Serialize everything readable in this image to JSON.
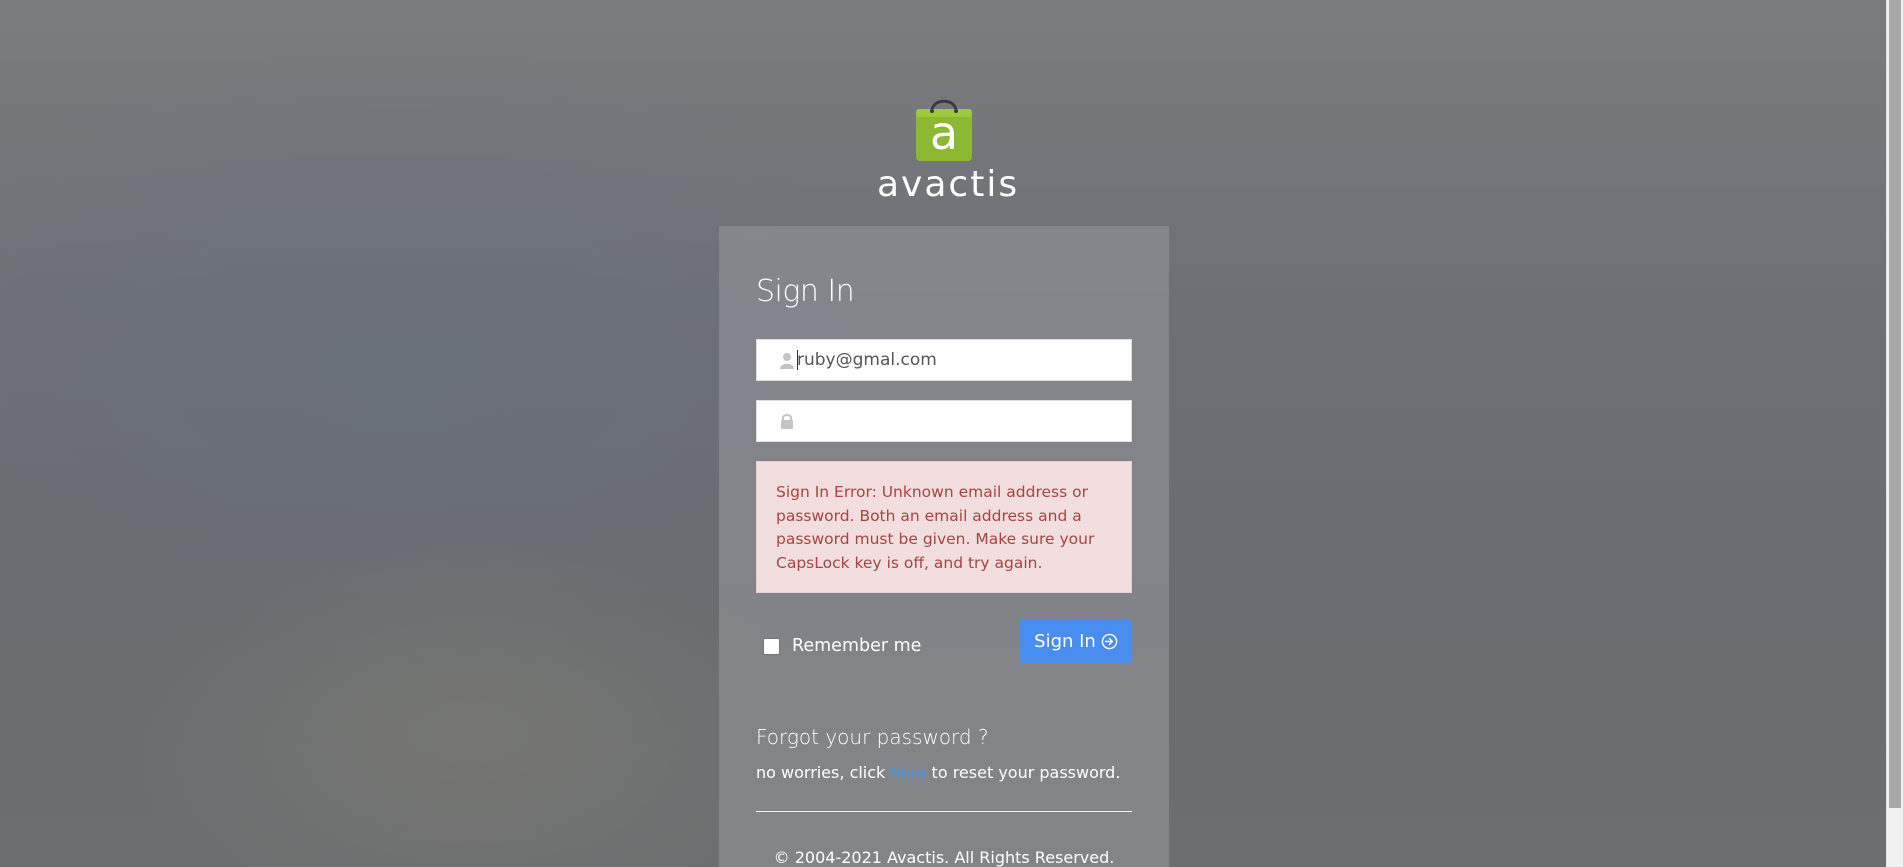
{
  "brand": {
    "logo_letter": "a",
    "logo_text": "avactis",
    "logo_color": "#8cb832"
  },
  "signin": {
    "title": "Sign In",
    "email_value": "ruby@gmal.com",
    "email_icon": "user-icon",
    "password_value": "",
    "password_icon": "lock-icon",
    "error_message": "Sign In Error: Unknown email address or password. Both an email address and a password must be given. Make sure your CapsLock key is off, and try again.",
    "remember_label": "Remember me",
    "remember_checked": false,
    "button_label": "Sign In",
    "button_icon": "circle-arrow-right-icon",
    "button_color": "#4a8df0"
  },
  "forgot": {
    "title": "Forgot your password ?",
    "text_before": "no worries, click ",
    "link_text": "here",
    "text_after": " to reset your password."
  },
  "footer": {
    "copyright": "© 2004-2021 Avactis. All Rights Reserved."
  },
  "colors": {
    "error_background": "#f2dede",
    "error_text": "#a94442",
    "link": "#4a90e2"
  }
}
